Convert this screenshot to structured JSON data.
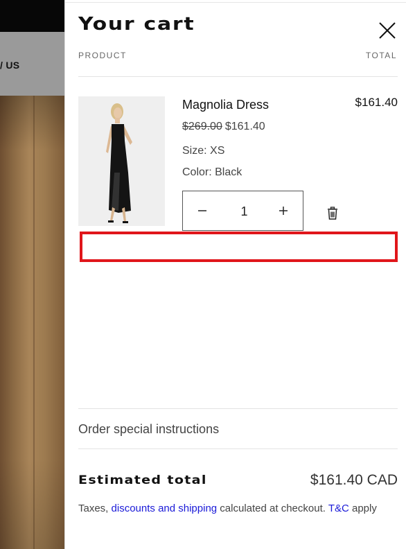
{
  "background": {
    "nav_fragment": "/ US"
  },
  "cart": {
    "title": "Your cart",
    "columns": {
      "product": "PRODUCT",
      "total": "TOTAL"
    },
    "items": [
      {
        "name": "Magnolia Dress",
        "original_price": "$269.00",
        "sale_price": "$161.40",
        "line_total": "$161.40",
        "size_label": "Size: XS",
        "color_label": "Color: Black",
        "quantity": "1"
      }
    ],
    "special_instructions": "Order special instructions",
    "estimated_total_label": "Estimated total",
    "estimated_total_value": "$161.40 CAD",
    "tax_note": {
      "before": "Taxes, ",
      "link1": "discounts and shipping",
      "middle": " calculated at checkout. ",
      "link2": "T&C",
      "after": " apply"
    }
  },
  "colors": {
    "highlight": "#e0161b",
    "link": "#1a1ad8"
  },
  "icons": {
    "close": "close-icon",
    "minus": "minus-icon",
    "plus": "plus-icon",
    "trash": "trash-icon"
  }
}
